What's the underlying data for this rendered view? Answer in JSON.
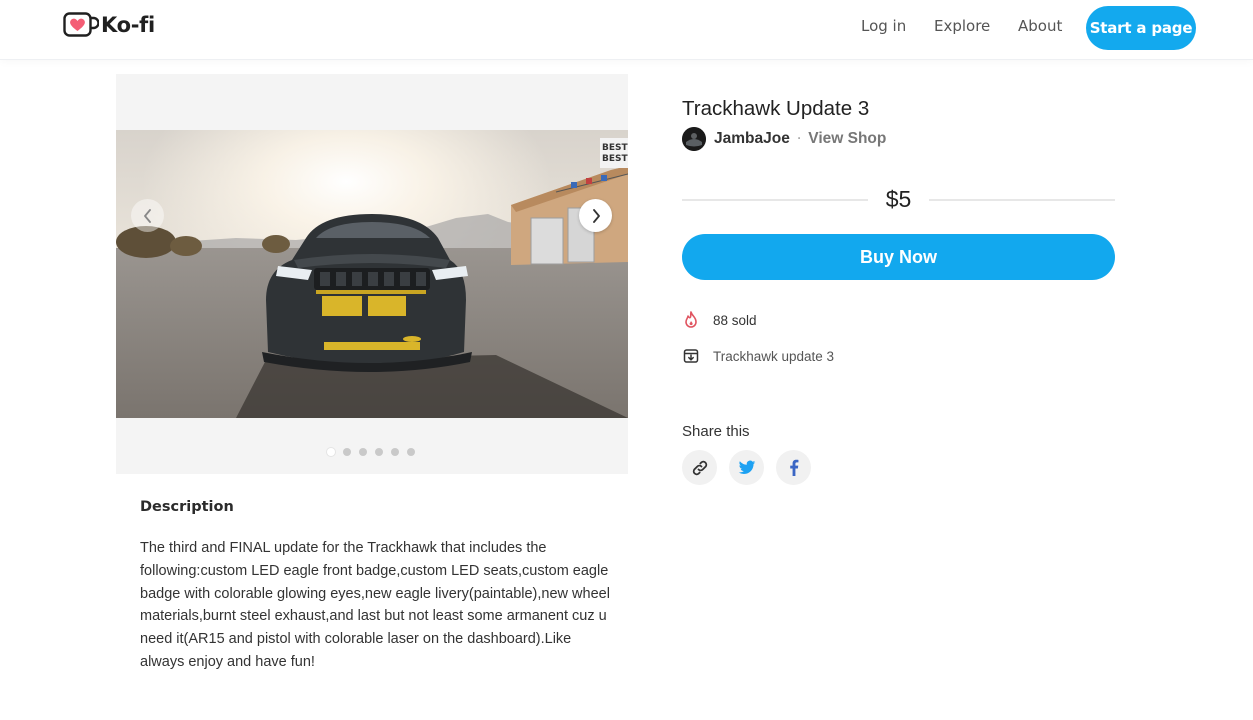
{
  "header": {
    "logo_text": "Ko-fi",
    "nav": {
      "login": "Log in",
      "explore": "Explore",
      "about": "About"
    },
    "start_page_label": "Start a page"
  },
  "gallery": {
    "slide_count": 6,
    "active_slide": 1
  },
  "product": {
    "title": "Trackhawk Update 3",
    "creator": "JambaJoe",
    "separator": "·",
    "view_shop_label": "View Shop",
    "price": "$5",
    "buy_label": "Buy Now",
    "sold_text": "88 sold",
    "file_name": "Trackhawk update 3"
  },
  "share": {
    "title": "Share this",
    "buttons": [
      "link-icon",
      "twitter-icon",
      "facebook-icon"
    ]
  },
  "description": {
    "title": "Description",
    "text": "The third and FINAL update for the Trackhawk that includes the following:custom LED eagle front badge,custom LED seats,custom eagle badge with colorable glowing eyes,new eagle livery(paintable),new wheel materials,burnt steel exhaust,and last but not least some armanent cuz u need it(AR15 and pistol with colorable laser on the dashboard).Like always enjoy and have fun!"
  },
  "colors": {
    "accent": "#13a9ee",
    "twitter": "#1da1f2",
    "facebook": "#3b66c4",
    "sold_icon": "#e05561"
  }
}
